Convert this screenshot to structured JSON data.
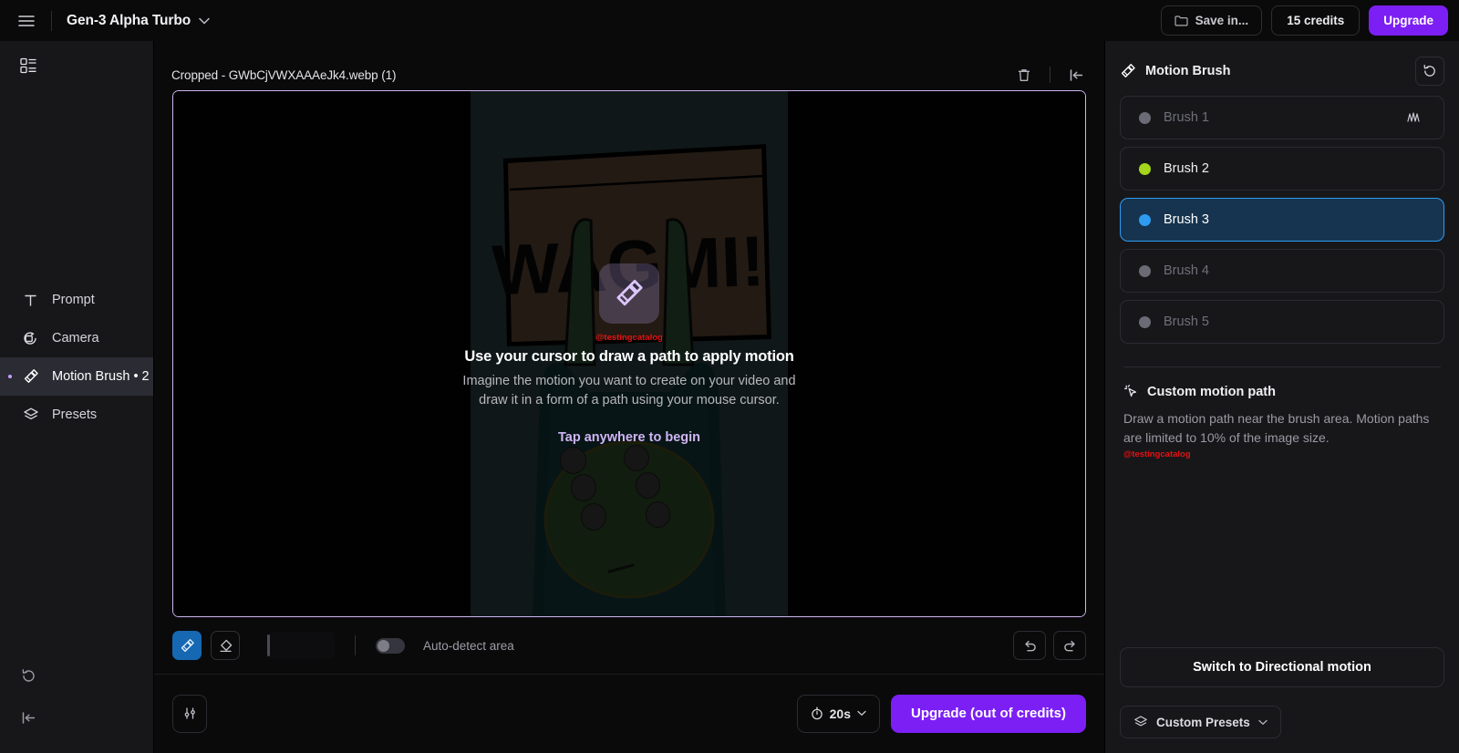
{
  "topbar": {
    "menu_icon": "hamburger-icon",
    "model_name": "Gen-3 Alpha Turbo",
    "model_chevron": "chevron-down-icon",
    "save_in_label": "Save in...",
    "save_in_icon": "folder-icon",
    "credits_label": "15 credits",
    "upgrade_label": "Upgrade",
    "accent": "#7c1ff5"
  },
  "rail": {
    "grid_icon": "layout-list-icon",
    "items": [
      {
        "label": "Prompt",
        "icon": "text-t-icon",
        "active": false
      },
      {
        "label": "Camera",
        "icon": "camera-rotate-icon",
        "active": false
      },
      {
        "label": "Motion Brush • 2",
        "icon": "paintbrush-icon",
        "active": true
      },
      {
        "label": "Presets",
        "icon": "layers-icon",
        "active": false
      }
    ],
    "bottom_icons": [
      "reset-history-icon",
      "collapse-panel-icon"
    ]
  },
  "center": {
    "file_title": "Cropped - GWbCjVWXAAAeJk4.webp (1)",
    "delete_icon": "trash-icon",
    "collapse_icon": "collapse-left-icon",
    "canvas_border_color": "#cdb4f0",
    "overlay": {
      "badge_icon": "paintbrush-icon",
      "watermark": "@testingcatalog",
      "title": "Use your cursor to draw a path to apply motion",
      "subtitle": "Imagine the motion you want to create on your video and draw it in a form of a path using your mouse cursor.",
      "cta": "Tap anywhere to begin"
    },
    "image_alt_text": "WAGMI!"
  },
  "toolstrip": {
    "brush_tool": {
      "name": "brush-tool",
      "icon": "paintbrush-icon",
      "selected": true
    },
    "eraser_tool": {
      "name": "eraser-tool",
      "icon": "eraser-icon",
      "selected": false
    },
    "brush_size_value": "",
    "auto_detect_label": "Auto-detect area",
    "auto_detect_on": false,
    "undo_icon": "undo-icon",
    "redo_icon": "redo-icon"
  },
  "bottombar": {
    "settings_icon": "sliders-icon",
    "duration_label": "20s",
    "duration_icon": "timer-icon",
    "duration_chevron": "chevron-down-icon",
    "generate_label": "Upgrade (out of credits)"
  },
  "rpanel": {
    "title": "Motion Brush",
    "title_icon": "paintbrush-icon",
    "reset_icon": "reset-icon",
    "brushes": [
      {
        "label": "Brush 1",
        "color": "#6b6b76",
        "state": "empty",
        "has_wave": true
      },
      {
        "label": "Brush 2",
        "color": "#a3d61c",
        "state": "filled",
        "has_wave": false
      },
      {
        "label": "Brush 3",
        "color": "#2e9bf0",
        "state": "active",
        "has_wave": false
      },
      {
        "label": "Brush 4",
        "color": "#6b6b76",
        "state": "empty",
        "has_wave": false
      },
      {
        "label": "Brush 5",
        "color": "#6b6b76",
        "state": "empty",
        "has_wave": false
      }
    ],
    "custom_motion": {
      "icon": "cursor-sparkle-icon",
      "title": "Custom motion path",
      "description": "Draw a motion path near the brush area. Motion paths are limited to 10% of the image size.",
      "watermark": "@testingcatalog"
    },
    "switch_label": "Switch to Directional motion",
    "presets_label": "Custom Presets",
    "presets_icon": "layers-icon",
    "presets_chevron": "chevron-down-icon"
  }
}
